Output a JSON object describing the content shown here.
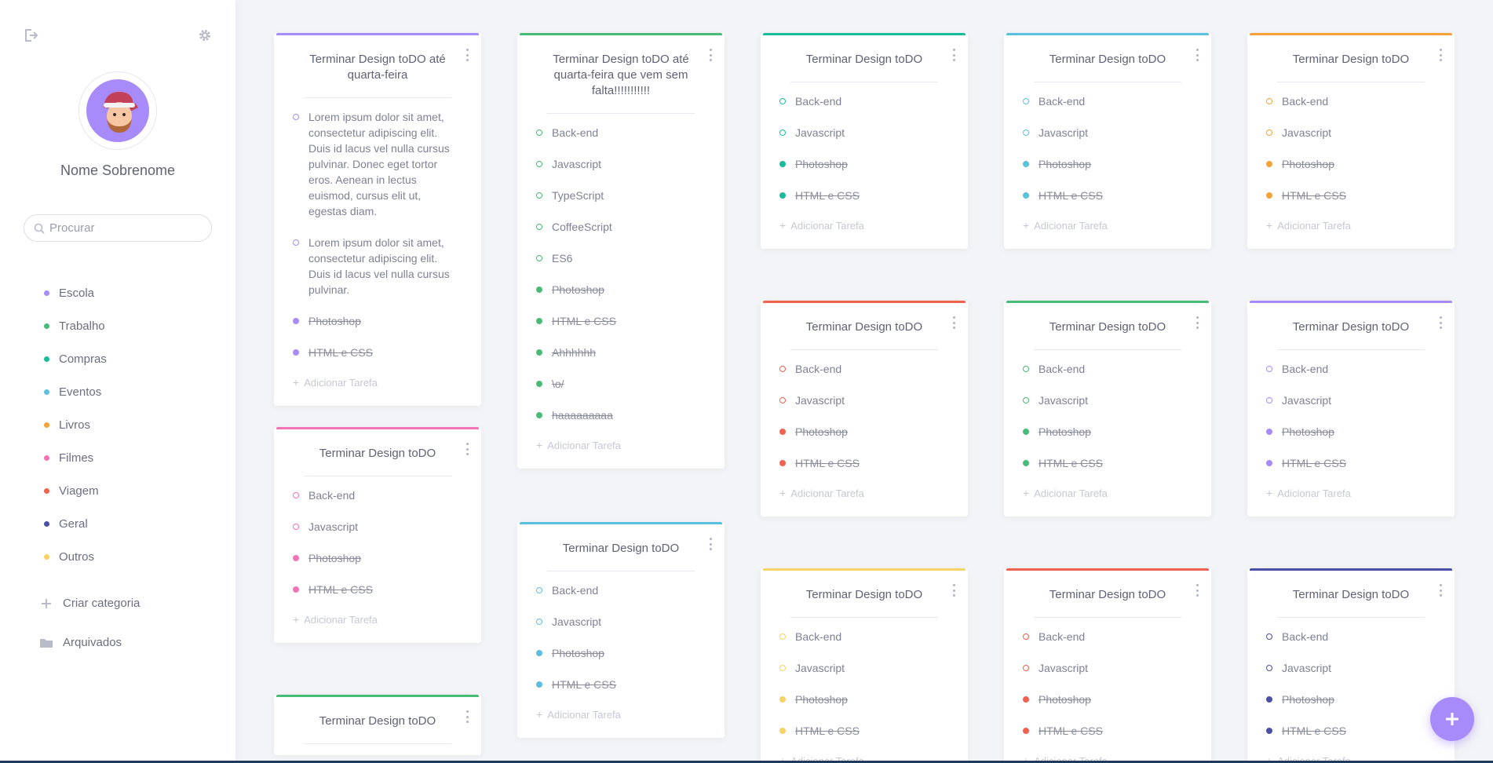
{
  "sidebar": {
    "user_name": "Nome Sobrenome",
    "search_placeholder": "Procurar",
    "categories": [
      {
        "label": "Escola",
        "color": "#a78bfa"
      },
      {
        "label": "Trabalho",
        "color": "#48bb78"
      },
      {
        "label": "Compras",
        "color": "#1abc9c"
      },
      {
        "label": "Eventos",
        "color": "#5bc0de"
      },
      {
        "label": "Livros",
        "color": "#f6a23a"
      },
      {
        "label": "Filmes",
        "color": "#f472b6"
      },
      {
        "label": "Viagem",
        "color": "#f0614f"
      },
      {
        "label": "Geral",
        "color": "#4b4fa6"
      },
      {
        "label": "Outros",
        "color": "#f6d365"
      }
    ],
    "create_category_label": "Criar categoria",
    "archived_label": "Arquivados"
  },
  "add_task_label": "Adicionar Tarefa",
  "cards": [
    {
      "title": "Terminar Design toDO até quarta-feira",
      "color": "#a78bfa",
      "tasks": [
        {
          "text": "Lorem ipsum dolor sit amet, consectetur adipiscing elit. Duis id lacus vel nulla cursus pulvinar. Donec eget tortor eros. Aenean in lectus euismod, cursus elit ut, egestas diam.",
          "done": false
        },
        {
          "text": "Lorem ipsum dolor sit amet, consectetur adipiscing elit. Duis id lacus vel nulla cursus pulvinar.",
          "done": false
        },
        {
          "text": "Photoshop",
          "done": true
        },
        {
          "text": "HTML e CSS",
          "done": true
        }
      ]
    },
    {
      "title": "Terminar Design toDO",
      "color": "#f472b6",
      "tasks": [
        {
          "text": "Back-end",
          "done": false
        },
        {
          "text": "Javascript",
          "done": false
        },
        {
          "text": "Photoshop",
          "done": true
        },
        {
          "text": "HTML e CSS",
          "done": true
        }
      ]
    },
    {
      "title": "Terminar Design toDO",
      "color": "#48bb78",
      "tasks": []
    },
    {
      "title": "Terminar Design toDO até quarta-feira que vem sem falta!!!!!!!!!!!",
      "color": "#48bb78",
      "tasks": [
        {
          "text": "Back-end",
          "done": false
        },
        {
          "text": "Javascript",
          "done": false
        },
        {
          "text": "TypeScript",
          "done": false
        },
        {
          "text": "CoffeeScript",
          "done": false
        },
        {
          "text": "ES6",
          "done": false
        },
        {
          "text": "Photoshop",
          "done": true
        },
        {
          "text": "HTML e CSS",
          "done": true
        },
        {
          "text": "Ahhhhhh",
          "done": true
        },
        {
          "text": "\\o/",
          "done": true
        },
        {
          "text": "haaaaaaaaa",
          "done": true
        }
      ]
    },
    {
      "title": "Terminar Design toDO",
      "color": "#5bc0de",
      "tasks": [
        {
          "text": "Back-end",
          "done": false
        },
        {
          "text": "Javascript",
          "done": false
        },
        {
          "text": "Photoshop",
          "done": true
        },
        {
          "text": "HTML e CSS",
          "done": true
        }
      ]
    },
    {
      "title": "Terminar Design toDO",
      "color": "#1abc9c",
      "tasks": [
        {
          "text": "Back-end",
          "done": false
        },
        {
          "text": "Javascript",
          "done": false
        },
        {
          "text": "Photoshop",
          "done": true
        },
        {
          "text": "HTML e CSS",
          "done": true
        }
      ]
    },
    {
      "title": "Terminar Design toDO",
      "color": "#f0614f",
      "tasks": [
        {
          "text": "Back-end",
          "done": false
        },
        {
          "text": "Javascript",
          "done": false
        },
        {
          "text": "Photoshop",
          "done": true
        },
        {
          "text": "HTML e CSS",
          "done": true
        }
      ]
    },
    {
      "title": "Terminar Design toDO",
      "color": "#f6d365",
      "tasks": [
        {
          "text": "Back-end",
          "done": false
        },
        {
          "text": "Javascript",
          "done": false
        },
        {
          "text": "Photoshop",
          "done": true
        },
        {
          "text": "HTML e CSS",
          "done": true
        }
      ]
    },
    {
      "title": "Terminar Design toDO",
      "color": "#5bc0de",
      "tasks": [
        {
          "text": "Back-end",
          "done": false
        },
        {
          "text": "Javascript",
          "done": false
        },
        {
          "text": "Photoshop",
          "done": true
        },
        {
          "text": "HTML e CSS",
          "done": true
        }
      ]
    },
    {
      "title": "Terminar Design toDO",
      "color": "#48bb78",
      "tasks": [
        {
          "text": "Back-end",
          "done": false
        },
        {
          "text": "Javascript",
          "done": false
        },
        {
          "text": "Photoshop",
          "done": true
        },
        {
          "text": "HTML e CSS",
          "done": true
        }
      ]
    },
    {
      "title": "Terminar Design toDO",
      "color": "#f0614f",
      "tasks": [
        {
          "text": "Back-end",
          "done": false
        },
        {
          "text": "Javascript",
          "done": false
        },
        {
          "text": "Photoshop",
          "done": true
        },
        {
          "text": "HTML e CSS",
          "done": true
        }
      ]
    },
    {
      "title": "Terminar Design toDO",
      "color": "#f6a23a",
      "tasks": [
        {
          "text": "Back-end",
          "done": false
        },
        {
          "text": "Javascript",
          "done": false
        },
        {
          "text": "Photoshop",
          "done": true
        },
        {
          "text": "HTML e CSS",
          "done": true
        }
      ]
    },
    {
      "title": "Terminar Design toDO",
      "color": "#a78bfa",
      "tasks": [
        {
          "text": "Back-end",
          "done": false
        },
        {
          "text": "Javascript",
          "done": false
        },
        {
          "text": "Photoshop",
          "done": true
        },
        {
          "text": "HTML e CSS",
          "done": true
        }
      ]
    },
    {
      "title": "Terminar Design toDO",
      "color": "#4b4fa6",
      "tasks": [
        {
          "text": "Back-end",
          "done": false
        },
        {
          "text": "Javascript",
          "done": false
        },
        {
          "text": "Photoshop",
          "done": true
        },
        {
          "text": "HTML e CSS",
          "done": true
        }
      ]
    }
  ]
}
